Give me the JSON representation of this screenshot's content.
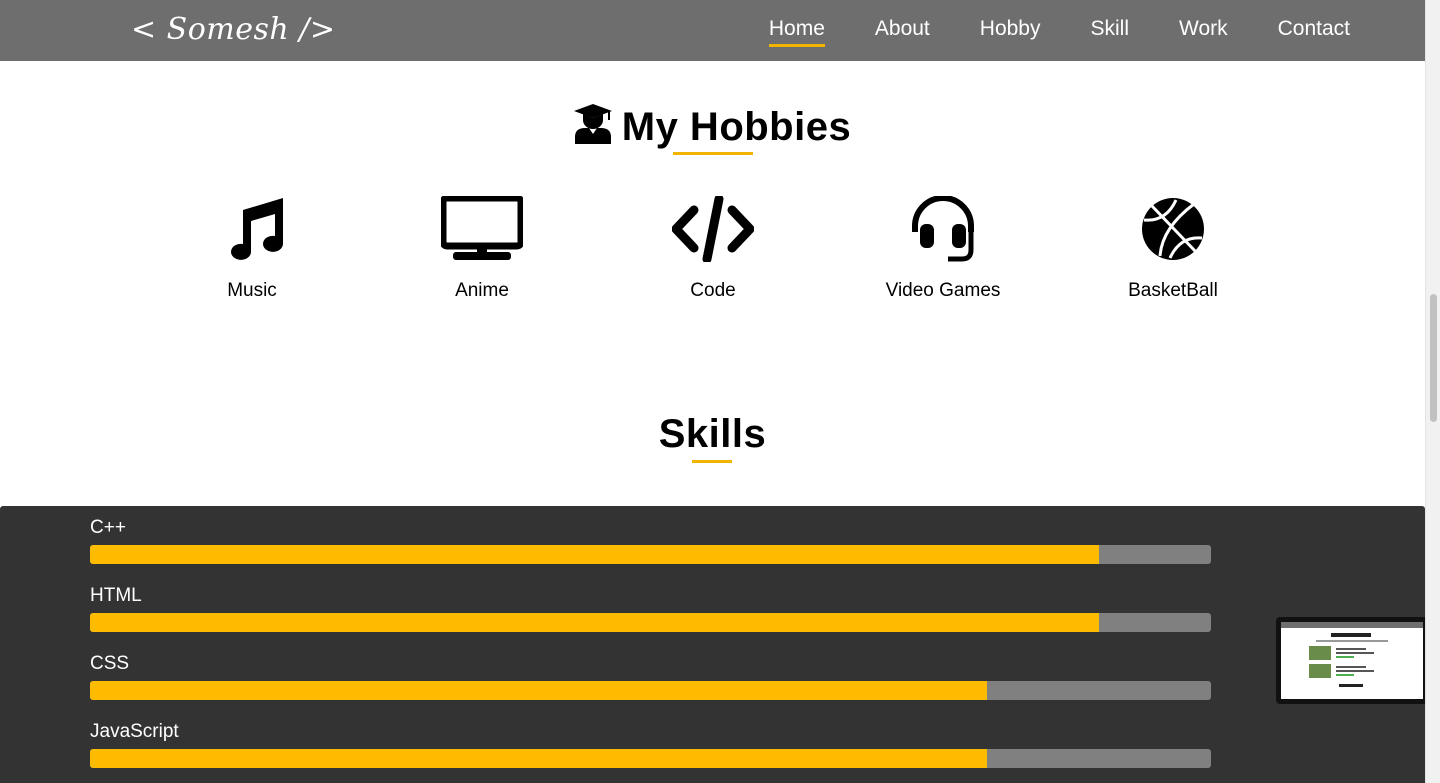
{
  "nav": {
    "logo": "< Somesh />",
    "links": [
      {
        "label": "Home",
        "active": true
      },
      {
        "label": "About",
        "active": false
      },
      {
        "label": "Hobby",
        "active": false
      },
      {
        "label": "Skill",
        "active": false
      },
      {
        "label": "Work",
        "active": false
      },
      {
        "label": "Contact",
        "active": false
      }
    ]
  },
  "hobbies": {
    "title": "My Hobbies",
    "title_icon": "graduate-icon",
    "items": [
      {
        "label": "Music",
        "icon": "music-icon"
      },
      {
        "label": "Anime",
        "icon": "tv-icon"
      },
      {
        "label": "Code",
        "icon": "code-icon"
      },
      {
        "label": "Video Games",
        "icon": "headset-icon"
      },
      {
        "label": "BasketBall",
        "icon": "basketball-icon"
      }
    ]
  },
  "skills": {
    "title": "Skills",
    "items": [
      {
        "name": "C++",
        "level": 0.9
      },
      {
        "name": "HTML",
        "level": 0.9
      },
      {
        "name": "CSS",
        "level": 0.8
      },
      {
        "name": "JavaScript",
        "level": 0.8
      }
    ]
  },
  "colors": {
    "navbar": "#6e6e6e",
    "accent": "#ffbb00",
    "skills_bg": "#333333",
    "bar_track": "#808080"
  }
}
